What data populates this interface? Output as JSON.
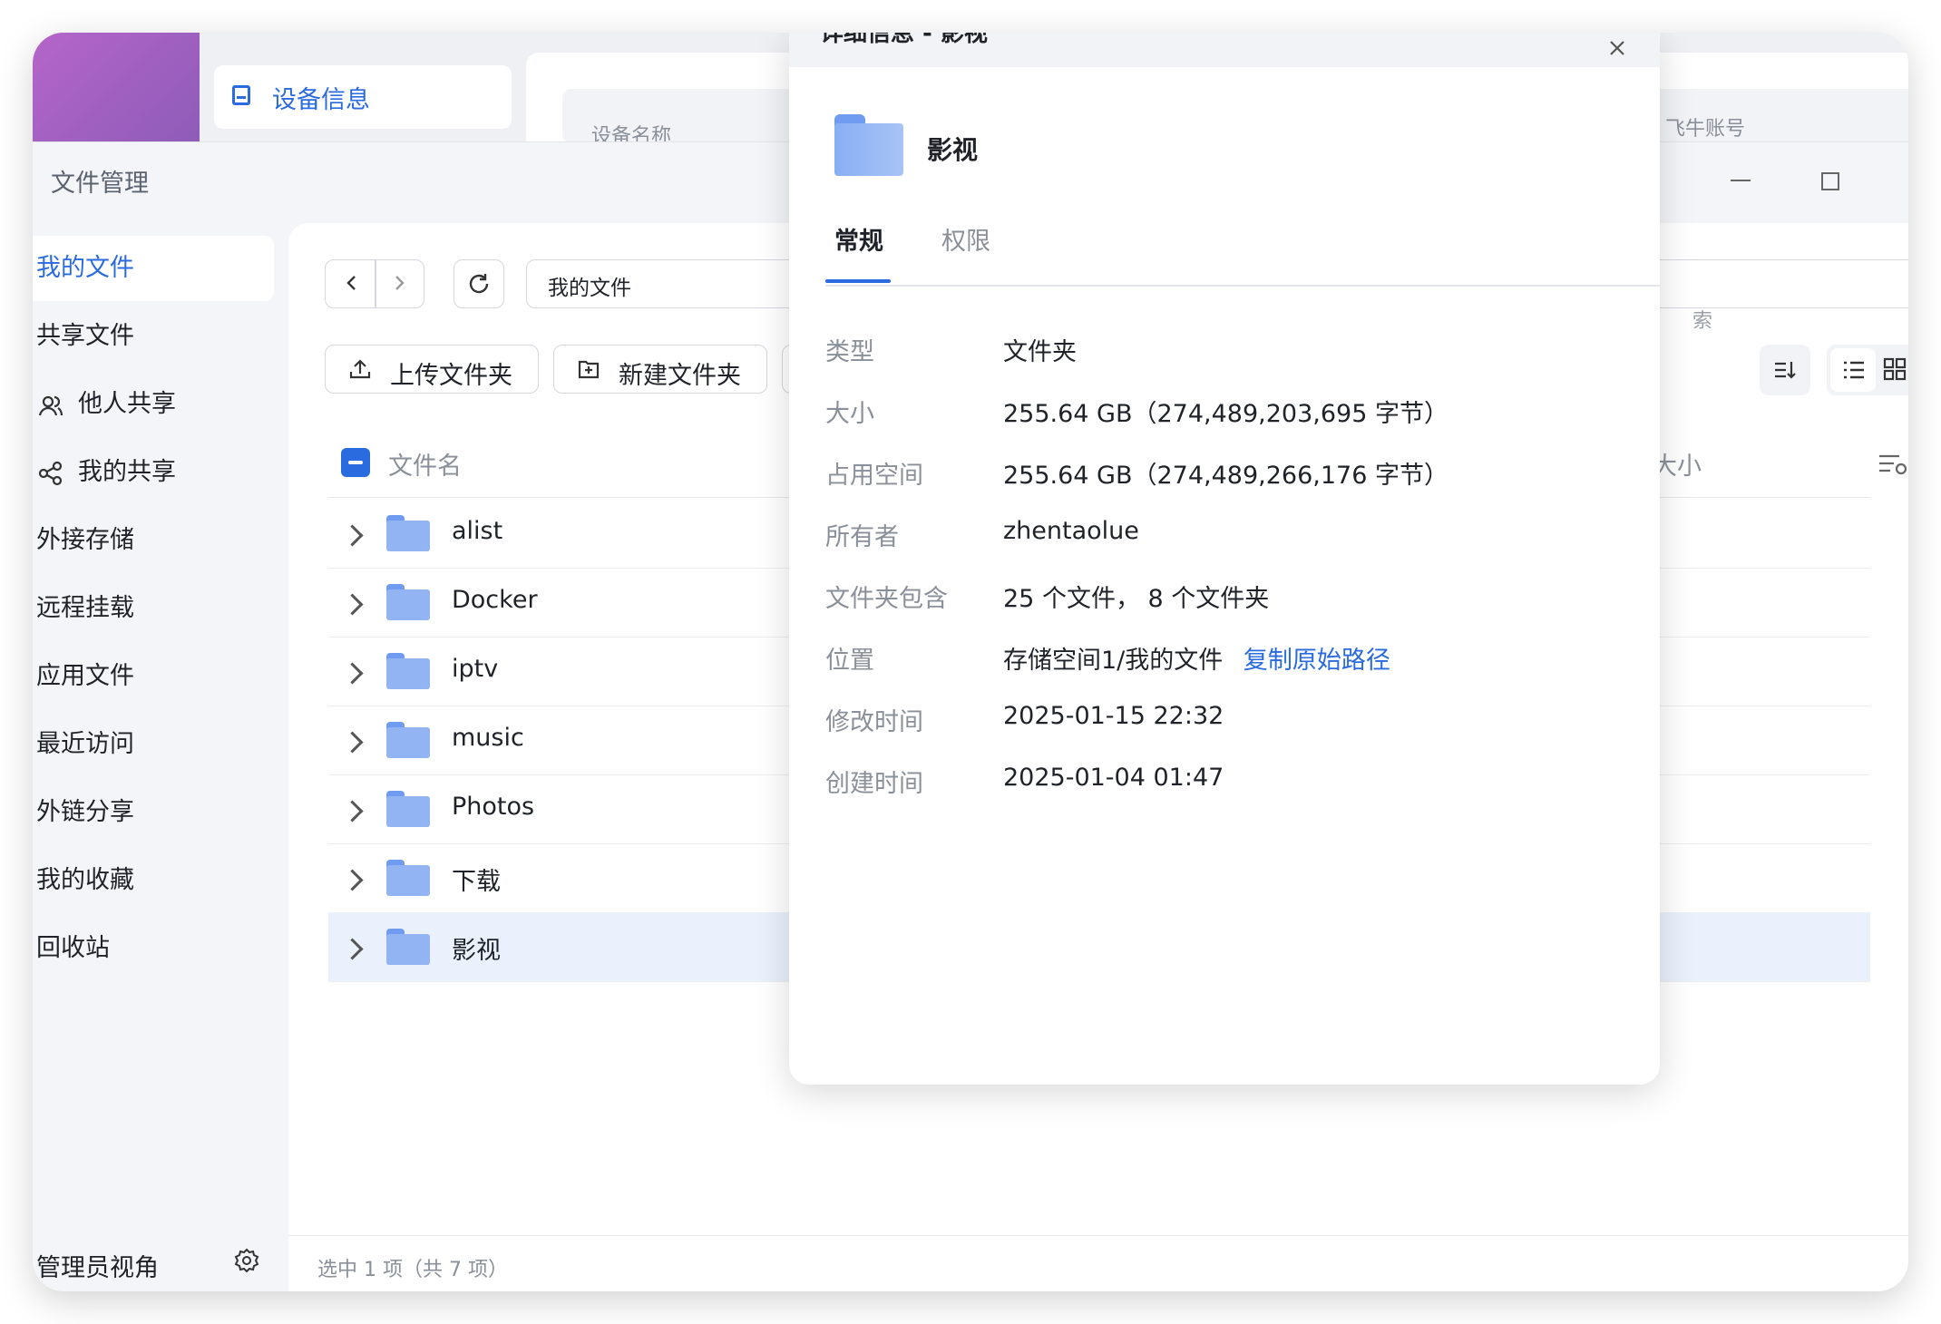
{
  "background": {
    "device_info_tab": "设备信息",
    "device_name_label": "设备名称",
    "account_label": "飞牛账号"
  },
  "window": {
    "title": "文件管理"
  },
  "sidebar": {
    "items": [
      {
        "label": "我的文件",
        "icon": "",
        "active": true
      },
      {
        "label": "共享文件",
        "icon": ""
      },
      {
        "label": "他人共享",
        "icon": "users-icon"
      },
      {
        "label": "我的共享",
        "icon": "share-icon"
      },
      {
        "label": "外接存储",
        "icon": ""
      },
      {
        "label": "远程挂载",
        "icon": ""
      },
      {
        "label": "应用文件",
        "icon": ""
      },
      {
        "label": "最近访问",
        "icon": ""
      },
      {
        "label": "外链分享",
        "icon": ""
      },
      {
        "label": "我的收藏",
        "icon": ""
      },
      {
        "label": "回收站",
        "icon": ""
      }
    ],
    "admin_view": "管理员视角"
  },
  "toolbar": {
    "path": "我的文件",
    "upload_folder": "上传文件夹",
    "new_folder": "新建文件夹",
    "search_placeholder_partial": "索"
  },
  "table": {
    "col_name": "文件名",
    "col_size": "大小",
    "rows": [
      {
        "name": "alist"
      },
      {
        "name": "Docker"
      },
      {
        "name": "iptv"
      },
      {
        "name": "music"
      },
      {
        "name": "Photos"
      },
      {
        "name": "下载"
      },
      {
        "name": "影视",
        "selected": true
      }
    ]
  },
  "status": {
    "text": "选中 1 项（共 7 项）"
  },
  "dialog": {
    "title": "详细信息 - 影视",
    "folder_name": "影视",
    "tabs": [
      "常规",
      "权限"
    ],
    "properties": [
      {
        "label": "类型",
        "value": "文件夹"
      },
      {
        "label": "大小",
        "value": "255.64 GB（274,489,203,695 字节）"
      },
      {
        "label": "占用空间",
        "value": "255.64 GB（274,489,266,176 字节）"
      },
      {
        "label": "所有者",
        "value": "zhentaolue"
      },
      {
        "label": "文件夹包含",
        "value": "25 个文件， 8 个文件夹"
      },
      {
        "label": "位置",
        "value": "存储空间1/我的文件",
        "link": "复制原始路径"
      },
      {
        "label": "修改时间",
        "value": "2025-01-15 22:32"
      },
      {
        "label": "创建时间",
        "value": "2025-01-04 01:47"
      }
    ]
  },
  "colors": {
    "accent": "#2a6bdf",
    "folder": "#93b4f3",
    "selected_row": "#eaf1fc"
  }
}
